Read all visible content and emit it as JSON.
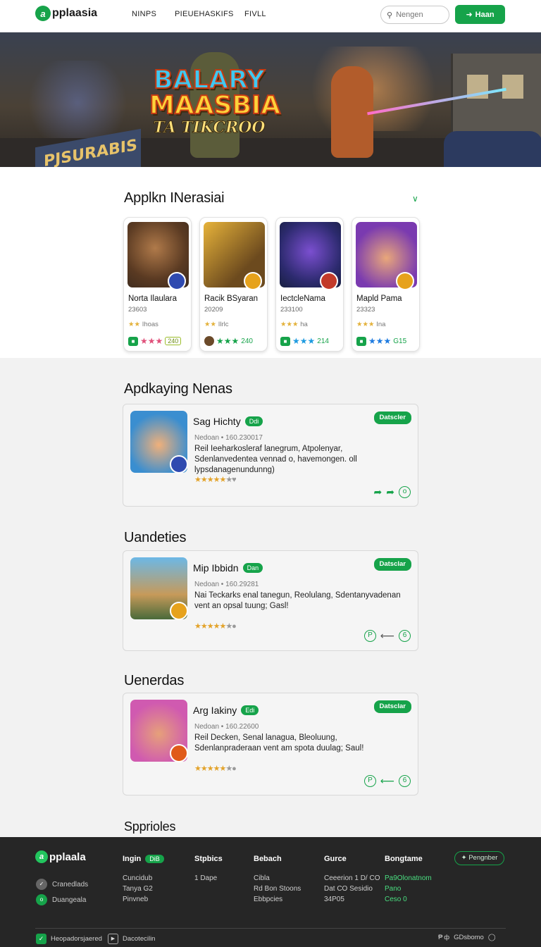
{
  "header": {
    "logo_text": "pplaasia",
    "nav": [
      "NINPS",
      "PIEUEHASKIFS",
      "FIVLL"
    ],
    "search_placeholder": "Nengen",
    "button_label": "Haan",
    "accent": "#16a34a"
  },
  "hero": {
    "title_line1": "BALARY",
    "title_line2": "MAASBIA",
    "title_line3": "TA TIKCROO",
    "sign_text": "PJSURABIS"
  },
  "featured": {
    "title": "Applkn INerasiai",
    "cards": [
      {
        "name": "Norta Ilaulara",
        "number": "23603",
        "rating": "Ihoas",
        "actions": "240"
      },
      {
        "name": "Racik BSyaran",
        "number": "20209",
        "rating": "Ilrlc",
        "actions": "240"
      },
      {
        "name": "IectcleNama",
        "number": "233100",
        "rating": "ha",
        "actions": "214"
      },
      {
        "name": "Mapld Pama",
        "number": "23323",
        "rating": "Ina",
        "actions": "G15"
      }
    ]
  },
  "sections": [
    {
      "title": "Apdkaying Nenas",
      "app": {
        "name": "Sag Hichty",
        "tag": "Ddi",
        "meta": "Nedoan  •  160.230017",
        "desc": "Reil Ieeharkosleraf lanegrum, Atpolenyar, Sdenlanvedentea vennad o, havemongen. oll lypsdanagenundunng)",
        "download": "Datscler"
      }
    },
    {
      "title": "Uandeties",
      "app": {
        "name": "Mip Ibbidn",
        "tag": "Dan",
        "meta": "Nedoan  •  160.29281",
        "desc": "Nai Teckarks enal tanegun, Reolulang, Sdentanyvadenan vent an opsal tuung; Gasl!",
        "download": "Datsclar"
      }
    },
    {
      "title": "Uenerdas",
      "app": {
        "name": "Arg Iakiny",
        "tag": "Edi",
        "meta": "Nedoan  •  160.22600",
        "desc": "Reil Decken, Senal lanagua, Bleoluung, Sdenlanpraderaan vent am spota duulag; Saul!",
        "download": "Datsclar"
      }
    }
  ],
  "bottom_heading": "Spprioles",
  "footer": {
    "logo_text": "pplaala",
    "social": [
      "Cranedlads",
      "Duangeala"
    ],
    "columns": [
      {
        "title": "Ingin",
        "pill": "DiB",
        "items": [
          "Cuncidub",
          "Tanya G2",
          "Pinvneb"
        ]
      },
      {
        "title": "Stpbics",
        "items": [
          "1 Dape"
        ]
      },
      {
        "title": "Bebach",
        "items": [
          "Cibla",
          "Rd Bon Stoons",
          "Ebbpcies"
        ]
      },
      {
        "title": "Gurce",
        "items": [
          "Ceeerion 1 D/ CO",
          "Dat CO Sesidio",
          "34P05"
        ]
      },
      {
        "title": "Bongtame",
        "items": [
          "Pa9Olonatnom",
          "Pano",
          "Ceso 0"
        ]
      }
    ],
    "button": "Pengnber",
    "bottom_left": [
      "Heopadorsjaered",
      "Dacotecilin"
    ],
    "bottom_right": "GDsbomo"
  }
}
